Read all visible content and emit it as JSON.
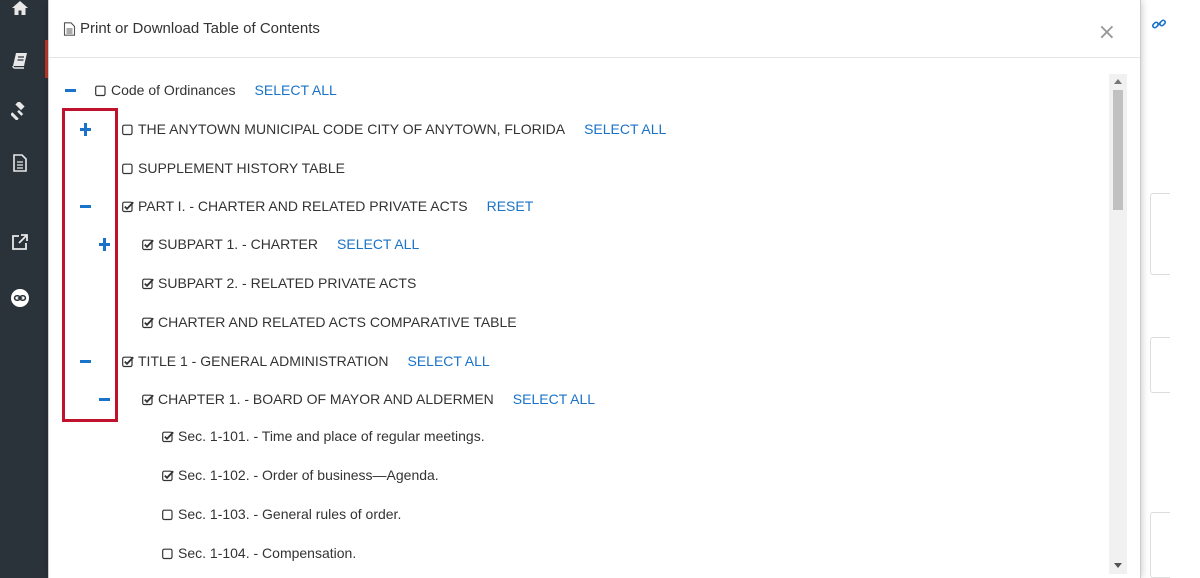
{
  "modal": {
    "title": "Print or Download Table of Contents",
    "close_label": "×"
  },
  "tree": {
    "nodes": [
      {
        "label": "Code of Ordinances",
        "toggle": "minus",
        "checked": false,
        "action": "SELECT ALL"
      },
      {
        "label": "THE ANYTOWN MUNICIPAL CODE CITY OF ANYTOWN, FLORIDA",
        "toggle": "plus",
        "checked": false,
        "action": "SELECT ALL"
      },
      {
        "label": "SUPPLEMENT HISTORY TABLE",
        "toggle": "none",
        "checked": false,
        "action": ""
      },
      {
        "label": "PART I. - CHARTER AND RELATED PRIVATE ACTS",
        "toggle": "minus",
        "checked": true,
        "action": "RESET"
      },
      {
        "label": "SUBPART 1. - CHARTER",
        "toggle": "plus",
        "checked": true,
        "action": "SELECT ALL"
      },
      {
        "label": "SUBPART 2. - RELATED PRIVATE ACTS",
        "toggle": "none",
        "checked": true,
        "action": ""
      },
      {
        "label": "CHARTER AND RELATED ACTS COMPARATIVE TABLE",
        "toggle": "none",
        "checked": true,
        "action": ""
      },
      {
        "label": "TITLE 1 - GENERAL ADMINISTRATION",
        "toggle": "minus",
        "checked": true,
        "action": "SELECT ALL"
      },
      {
        "label": "CHAPTER 1. - BOARD OF MAYOR AND ALDERMEN",
        "toggle": "minus",
        "checked": true,
        "action": "SELECT ALL"
      },
      {
        "label": "Sec. 1-101. - Time and place of regular meetings.",
        "toggle": "none",
        "checked": true,
        "action": ""
      },
      {
        "label": "Sec. 1-102. - Order of business—Agenda.",
        "toggle": "none",
        "checked": true,
        "action": ""
      },
      {
        "label": "Sec. 1-103. - General rules of order.",
        "toggle": "none",
        "checked": false,
        "action": ""
      },
      {
        "label": "Sec. 1-104. - Compensation.",
        "toggle": "none",
        "checked": false,
        "action": ""
      }
    ]
  },
  "sidebar": {
    "icons": [
      "home-icon",
      "book-icon",
      "gavel-icon",
      "document-icon",
      "external-link-icon",
      "chain-link-icon"
    ]
  },
  "colors": {
    "accent": "#1a73c8",
    "highlight": "#c0122c",
    "sidebar_bg": "#2b333a"
  }
}
